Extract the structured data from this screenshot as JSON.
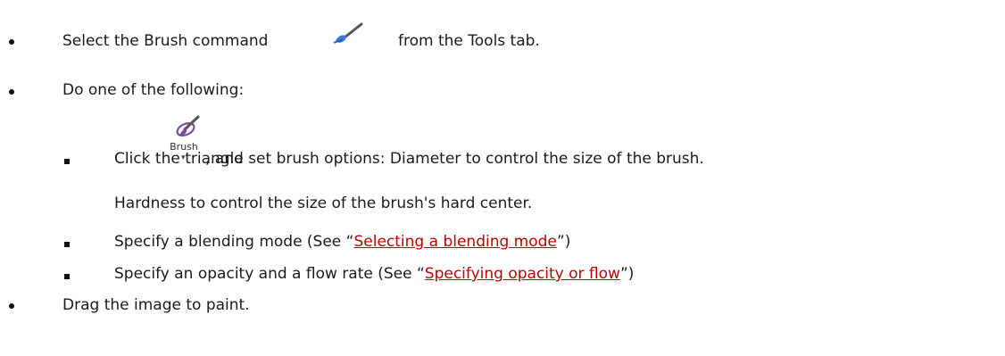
{
  "list": {
    "item1": {
      "before": "Select the Brush command",
      "after": "from the Tools tab.",
      "icon": "brush-tool-icon"
    },
    "item2": {
      "text": "Do one of the following:"
    },
    "brush_command": {
      "label": "Brush",
      "icon": "brush-ribbon-icon",
      "dropdown_icon": "triangle-down-icon"
    },
    "sub1": {
      "before": "Click the triangle",
      "after": ", and set brush options: Diameter to control the size of the brush.",
      "continuation": "Hardness to control the size of the brush's hard center."
    },
    "sub2": {
      "before": "Specify a blending mode (See “",
      "link": "Selecting a blending mode",
      "after": "”)"
    },
    "sub3": {
      "before": "Specify an opacity and a flow rate (See “",
      "link": "Specifying opacity or flow",
      "after": "”)"
    },
    "item3": {
      "text": "Drag the image to paint."
    }
  },
  "colors": {
    "link": "#c00000",
    "text": "#1a1a1a",
    "icon_purple": "#7b4aa8"
  }
}
